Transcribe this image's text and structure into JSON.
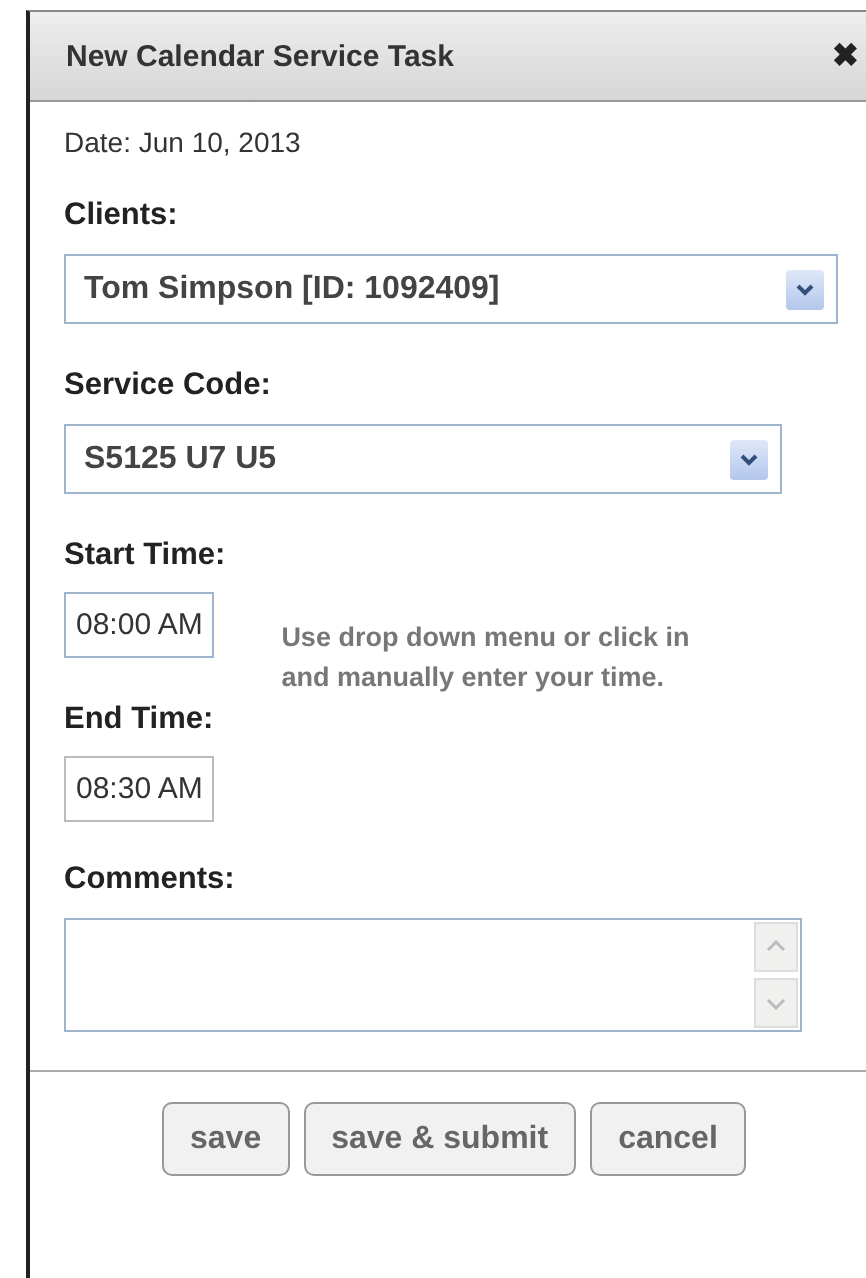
{
  "dialog": {
    "title": "New Calendar Service Task",
    "close": "✖"
  },
  "date": "Date: Jun 10, 2013",
  "clients": {
    "label": "Clients:",
    "value": "Tom Simpson [ID: 1092409]"
  },
  "service_code": {
    "label": "Service Code:",
    "value": "S5125 U7 U5"
  },
  "start_time": {
    "label": "Start Time:",
    "value": "08:00 AM"
  },
  "end_time": {
    "label": "End Time:",
    "value": "08:30 AM"
  },
  "help_text": "Use drop down menu or click in and manually enter your time.",
  "comments": {
    "label": "Comments:"
  },
  "buttons": [
    "save",
    "save & submit",
    "cancel"
  ]
}
